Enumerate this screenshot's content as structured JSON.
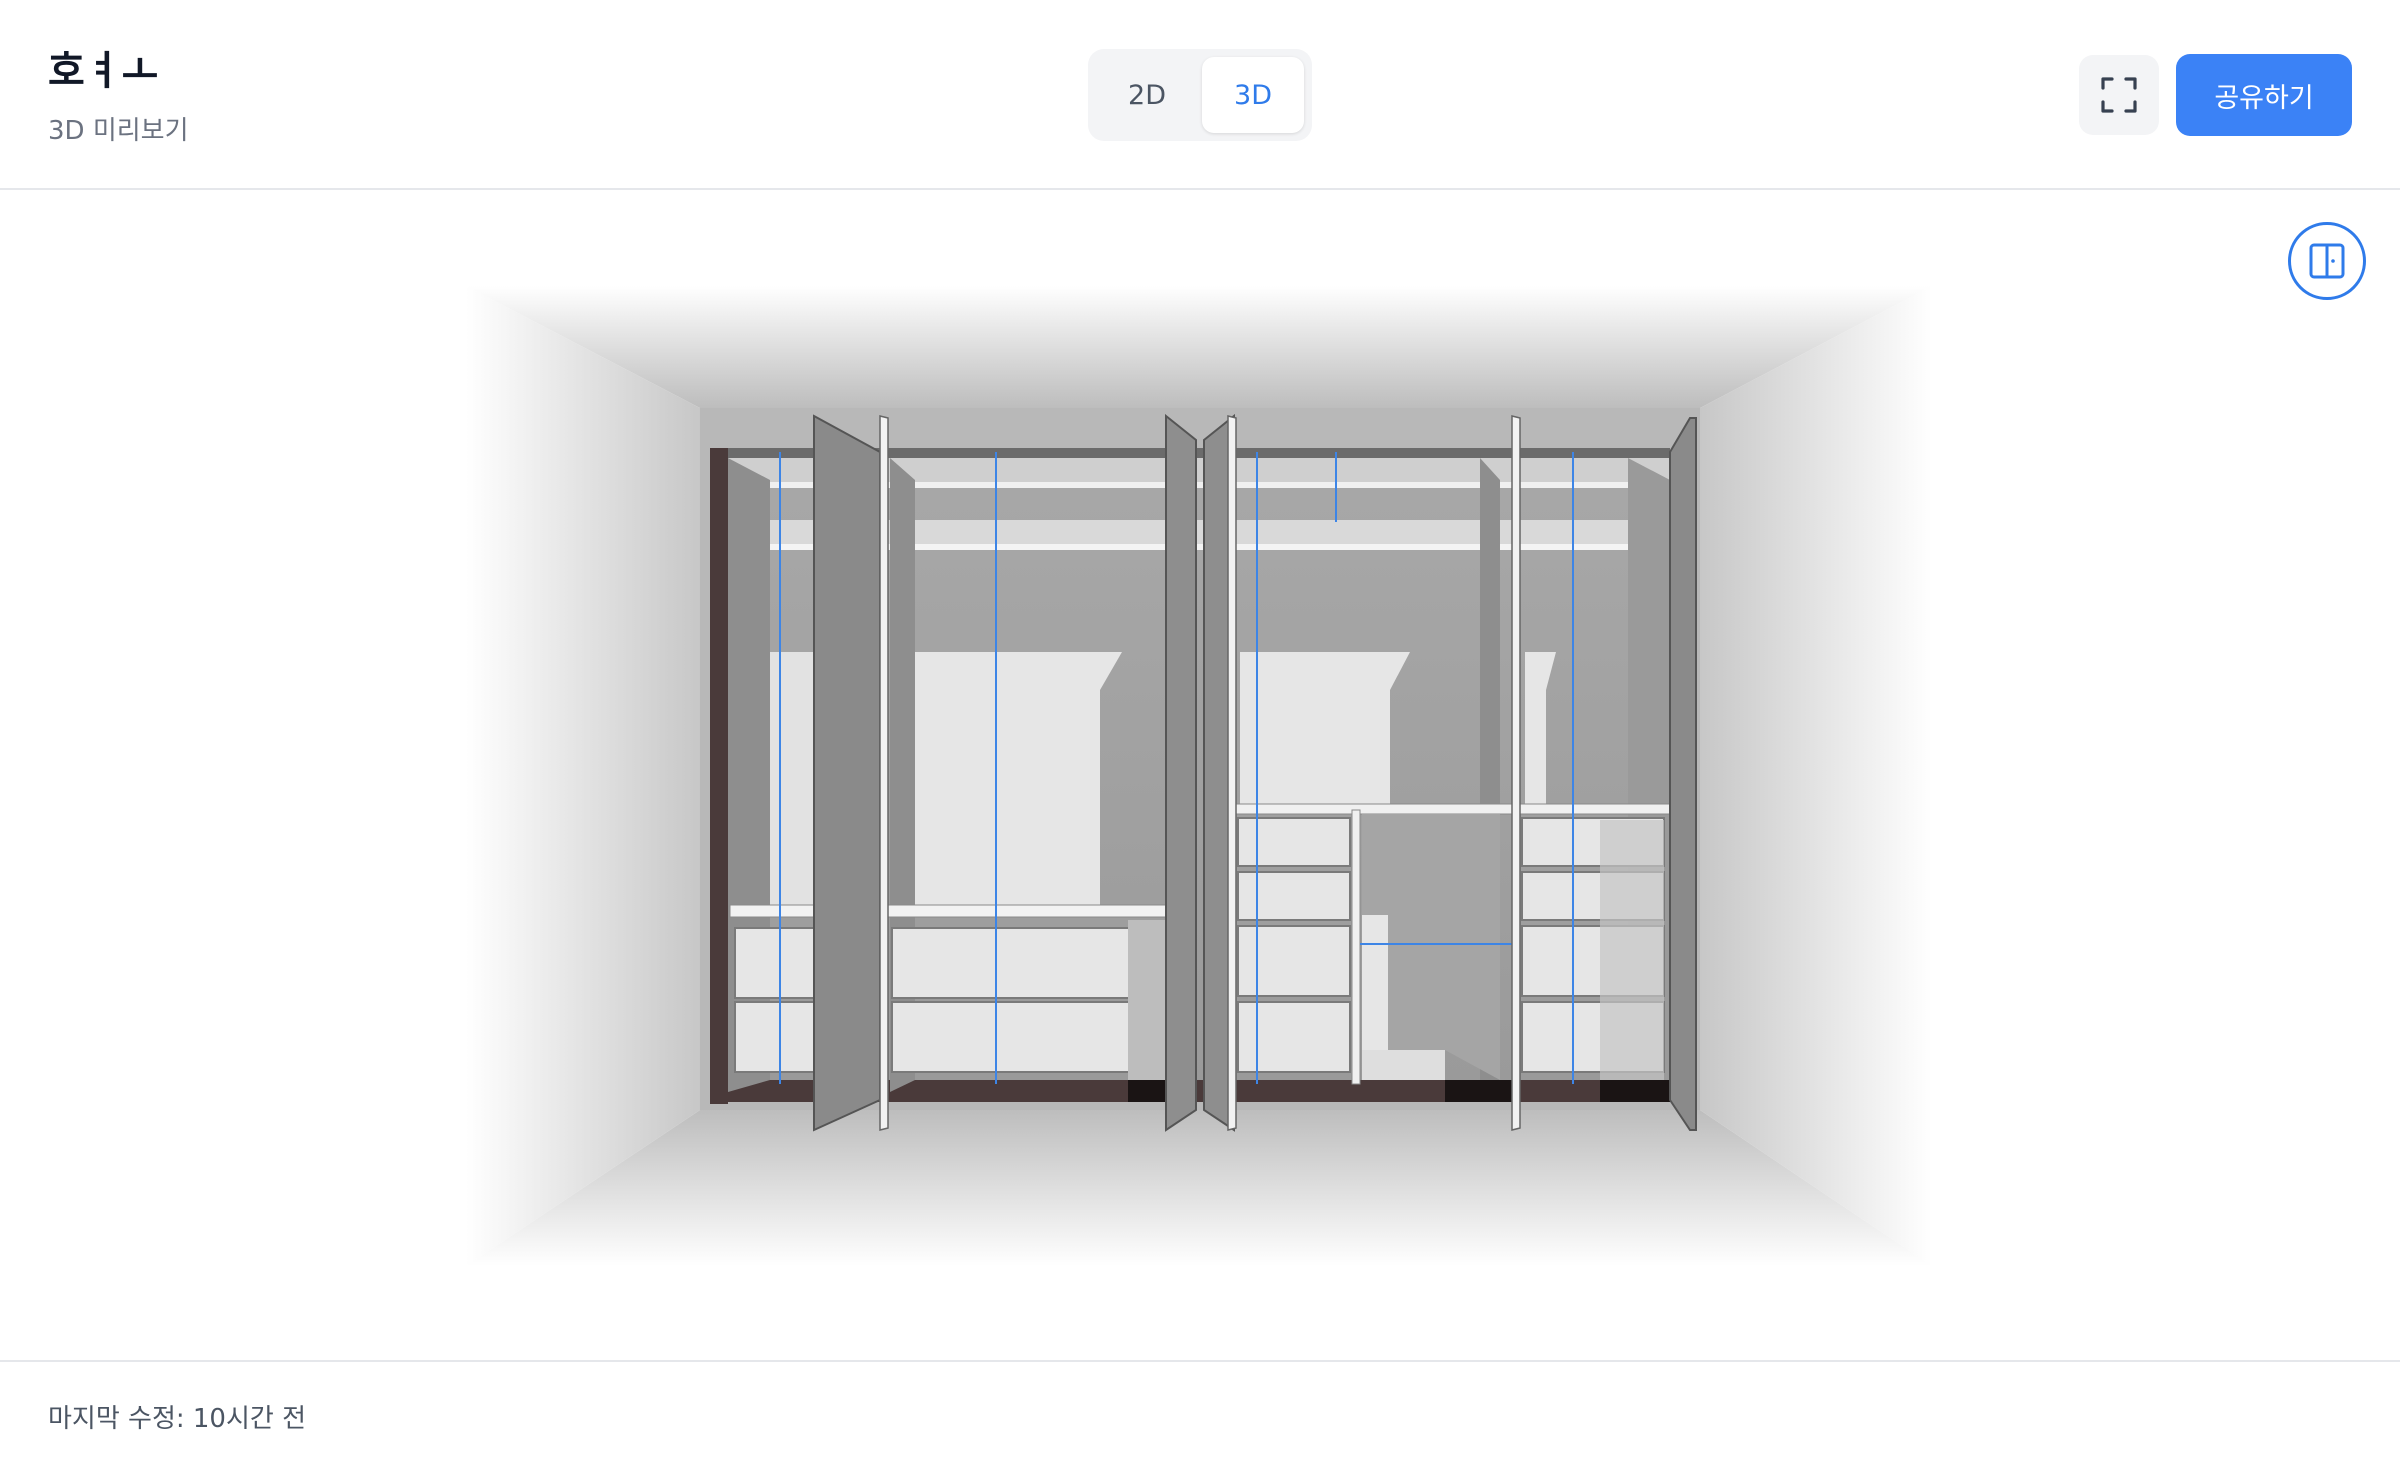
{
  "header": {
    "title": "호ㅕㅗ",
    "subtitle": "3D 미리보기",
    "view_toggle": {
      "options": [
        "2D",
        "3D"
      ],
      "selected": "3D"
    },
    "fullscreen_icon": "fullscreen-icon",
    "share_label": "공유하기"
  },
  "viewer": {
    "door_toggle_icon": "door-icon",
    "accent_color": "#2f7bea"
  },
  "footer": {
    "status": "마지막 수정: 10시간 전"
  }
}
